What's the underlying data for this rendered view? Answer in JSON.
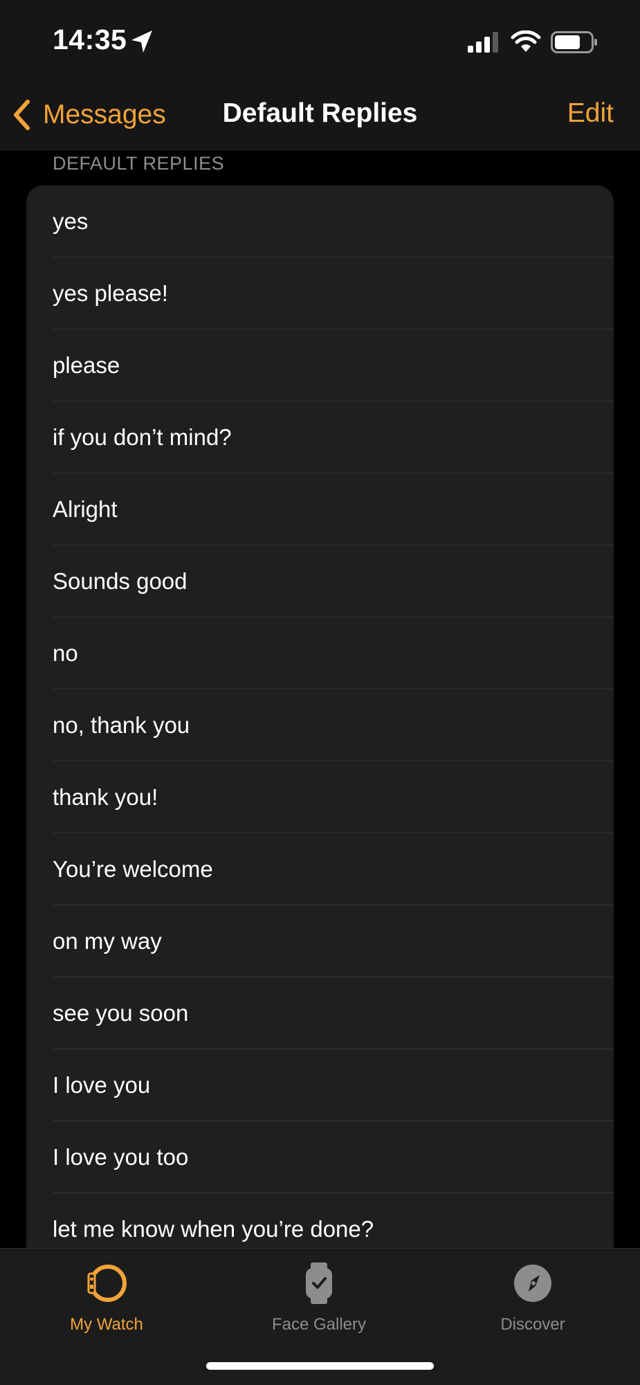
{
  "status_bar": {
    "time": "14:35",
    "icons": [
      "location-arrow-icon",
      "cellular-signal-icon",
      "wifi-icon",
      "battery-icon"
    ]
  },
  "nav": {
    "back_label": "Messages",
    "title": "Default Replies",
    "edit_label": "Edit"
  },
  "section": {
    "header": "DEFAULT REPLIES"
  },
  "replies": [
    "yes",
    "yes please!",
    "please",
    "if you don’t mind?",
    "Alright",
    "Sounds good",
    "no",
    "no, thank you",
    "thank you!",
    "You’re welcome",
    "on my way",
    "see you soon",
    "I love you",
    "I love you too",
    "let me know when you’re done?"
  ],
  "tabs": [
    {
      "label": "My Watch",
      "icon": "watch-icon",
      "active": true
    },
    {
      "label": "Face Gallery",
      "icon": "face-gallery-icon",
      "active": false
    },
    {
      "label": "Discover",
      "icon": "compass-icon",
      "active": false
    }
  ],
  "colors": {
    "accent": "#f2a33a",
    "background": "#000000",
    "card": "#1f1f1f",
    "inactive_tab": "#8d8d8d"
  }
}
